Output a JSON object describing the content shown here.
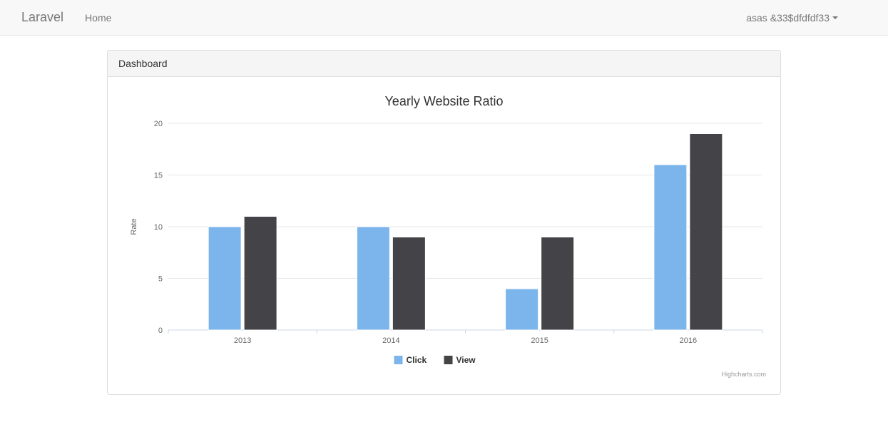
{
  "navbar": {
    "brand": "Laravel",
    "home_label": "Home",
    "user_label": "asas &33$dfdfdf33"
  },
  "panel": {
    "heading": "Dashboard"
  },
  "chart_data": {
    "type": "bar",
    "title": "Yearly Website Ratio",
    "ylabel": "Rate",
    "ylim": [
      0,
      20
    ],
    "yticks": [
      0,
      5,
      10,
      15,
      20
    ],
    "categories": [
      "2013",
      "2014",
      "2015",
      "2016"
    ],
    "series": [
      {
        "name": "Click",
        "color": "#7cb5ec",
        "values": [
          10,
          10,
          4,
          16
        ]
      },
      {
        "name": "View",
        "color": "#434348",
        "values": [
          11,
          9,
          9,
          19
        ]
      }
    ],
    "credits": "Highcharts.com"
  }
}
